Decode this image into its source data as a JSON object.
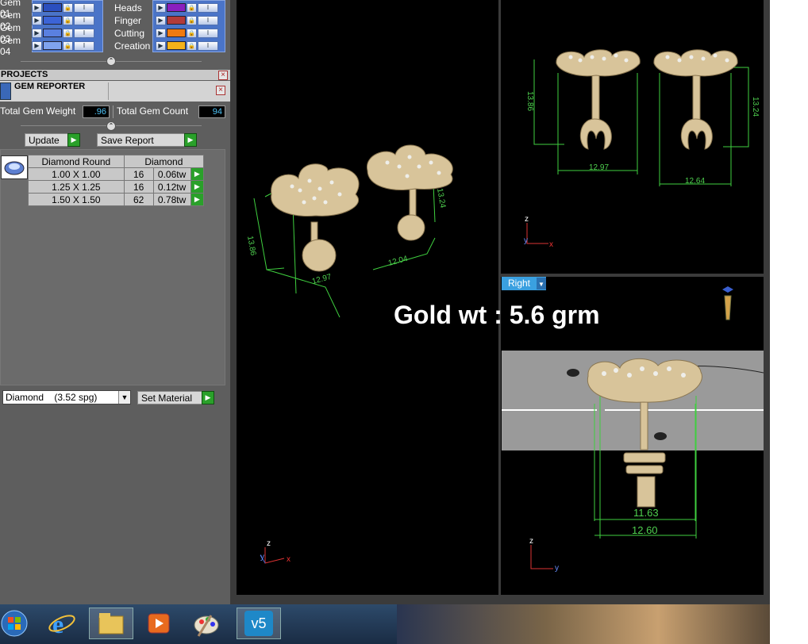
{
  "layers_left": [
    {
      "label": "Gem 01",
      "color": "#2b4fbf"
    },
    {
      "label": "Gem 02",
      "color": "#3c64d6"
    },
    {
      "label": "Gem 03",
      "color": "#5a80e0"
    },
    {
      "label": "Gem 04",
      "color": "#7fa3ee"
    }
  ],
  "layers_right": [
    {
      "label": "Heads",
      "color": "#8a1fbf"
    },
    {
      "label": "Finger",
      "color": "#b23b3b"
    },
    {
      "label": "Cutting",
      "color": "#f07a10"
    },
    {
      "label": "Creation",
      "color": "#f5b21a"
    }
  ],
  "panels": {
    "projects": "PROJECTS",
    "gem_reporter": "GEM REPORTER"
  },
  "stats": {
    "weight_label": "Total Gem Weight",
    "weight_value": ".96",
    "count_label": "Total Gem Count",
    "count_value": "94"
  },
  "buttons": {
    "update": "Update",
    "save_report": "Save Report",
    "set_material": "Set Material"
  },
  "gem_table": {
    "headers": [
      "Diamond Round",
      "Diamond"
    ],
    "rows": [
      {
        "size": "1.00 X 1.00",
        "count": "16",
        "tw": "0.06tw"
      },
      {
        "size": "1.25 X 1.25",
        "count": "16",
        "tw": "0.12tw"
      },
      {
        "size": "1.50 X 1.50",
        "count": "62",
        "tw": "0.78tw"
      }
    ]
  },
  "material": {
    "value": "Diamond    (3.52 spg)"
  },
  "viewport": {
    "overlay_text": "Gold wt : 5.6 grm",
    "right_view_label": "Right",
    "dims_perspective": [
      "13.86",
      "12.97",
      "12.04",
      "13.24"
    ],
    "dims_front": [
      "13.86",
      "12.97",
      "13.24",
      "12.64"
    ],
    "dims_right": [
      "11.63",
      "12.60"
    ],
    "axes": {
      "z": "z",
      "y": "y",
      "x": "x"
    }
  },
  "taskbar": {
    "apps": [
      "start-orb",
      "internet-explorer-icon",
      "file-explorer-icon",
      "media-player-icon",
      "paint-icon",
      "rhino-v5-icon"
    ],
    "rhino_label": "v5"
  }
}
